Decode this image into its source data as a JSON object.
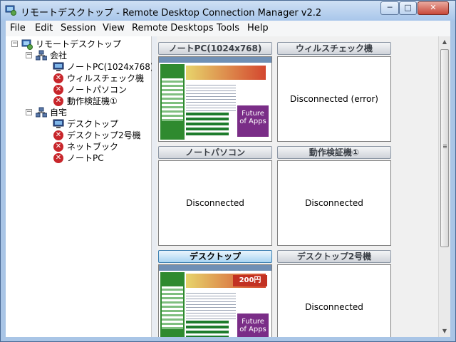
{
  "window": {
    "title": "リモートデスクトップ - Remote Desktop Connection Manager v2.2",
    "buttons": {
      "minimize": "─",
      "maximize": "□",
      "close": "✕"
    }
  },
  "menu": [
    "File",
    "Edit",
    "Session",
    "View",
    "Remote Desktops",
    "Tools",
    "Help"
  ],
  "tree": {
    "root": "リモートデスクトップ",
    "groups": [
      {
        "label": "会社",
        "items": [
          {
            "label": "ノートPC(1024x768)",
            "status": "connected"
          },
          {
            "label": "ウィルスチェック機",
            "status": "error"
          },
          {
            "label": "ノートパソコン",
            "status": "error"
          },
          {
            "label": "動作検証機①",
            "status": "error"
          }
        ]
      },
      {
        "label": "自宅",
        "items": [
          {
            "label": "デスクトップ",
            "status": "connected"
          },
          {
            "label": "デスクトップ2号機",
            "status": "error"
          },
          {
            "label": "ネットブック",
            "status": "error"
          },
          {
            "label": "ノートPC",
            "status": "error"
          }
        ]
      }
    ]
  },
  "tiles": [
    {
      "title": "ノートPC(1024x768)",
      "status": "",
      "preview": true,
      "active": false
    },
    {
      "title": "ウィルスチェック機",
      "status": "Disconnected (error)",
      "preview": false,
      "active": false
    },
    {
      "title": "ノートパソコン",
      "status": "Disconnected",
      "preview": false,
      "active": false
    },
    {
      "title": "動作検証機①",
      "status": "Disconnected",
      "preview": false,
      "active": false
    },
    {
      "title": "デスクトップ",
      "status": "",
      "preview": true,
      "active": true
    },
    {
      "title": "デスクトップ2号機",
      "status": "Disconnected",
      "preview": false,
      "active": false
    }
  ],
  "thumbnails": {
    "ad_text": "Future of Apps",
    "price_badge": "200円"
  },
  "colors": {
    "title_bar": "#a8c6ea",
    "error_icon": "#c8262b",
    "active_tile": "#a9d4f2"
  }
}
